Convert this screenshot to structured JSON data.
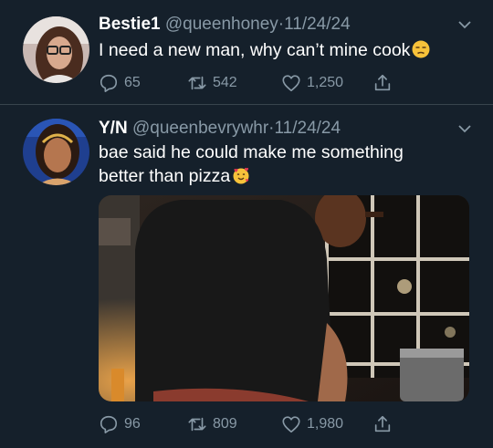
{
  "tweets": [
    {
      "name": "Bestie1",
      "handle": "@queenhoney",
      "dot": "·",
      "date": "11/24/24",
      "text": "I need a new man, why can’t mine cook",
      "emoji": "unamused-face",
      "replies": "65",
      "retweets": "542",
      "likes": "1,250"
    },
    {
      "name": "Y/N",
      "handle": "@queenbevrywhr",
      "dot": "·",
      "date": "11/24/24",
      "text_line1": "bae said he could make me something",
      "text_line2": "better than pizza",
      "emoji": "smiling-face-with-hearts",
      "replies": "96",
      "retweets": "809",
      "likes": "1,980"
    }
  ],
  "colors": {
    "background": "#15202b",
    "secondary_text": "#8899a6",
    "divider": "#38444d"
  },
  "icons": [
    "reply-icon",
    "retweet-icon",
    "like-icon",
    "share-icon",
    "chevron-down-icon"
  ]
}
